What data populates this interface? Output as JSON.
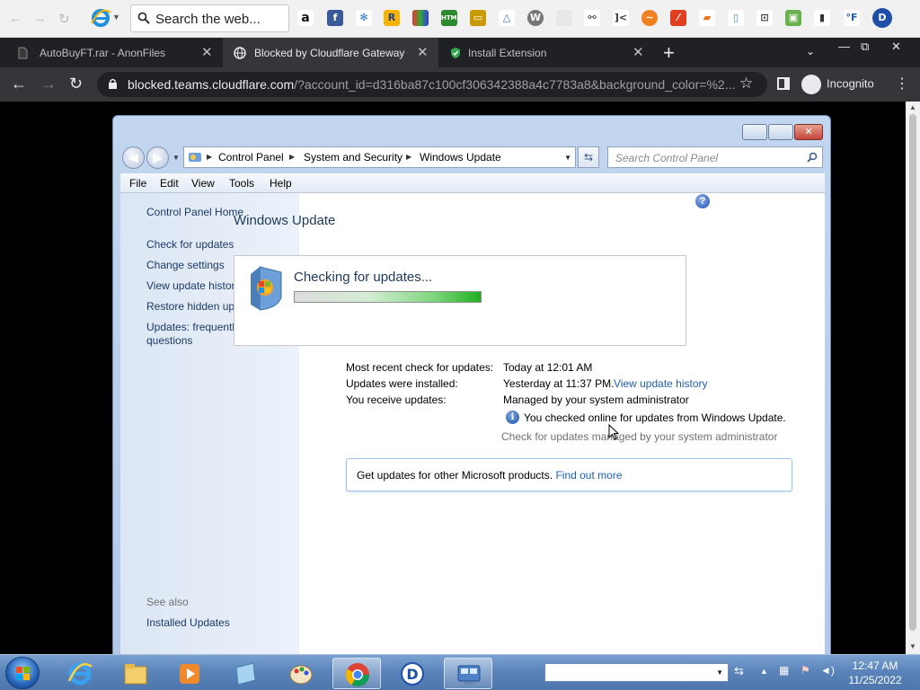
{
  "top_toolbar": {
    "search_placeholder": "Search the web...",
    "extension_icons": [
      "amazon-icon",
      "facebook-icon",
      "snowflake-icon",
      "r-badge-icon",
      "puzzle-icon",
      "html-icon",
      "folder-icon",
      "triangle-icon",
      "wordpress-icon",
      "wolf-icon",
      "network-icon",
      "bracket-icon",
      "sun-icon",
      "slash-icon",
      "sneaker-icon",
      "copy-icon",
      "car-icon",
      "android-icon",
      "phone-icon",
      "fahrenheit-icon",
      "d-icon"
    ],
    "f_label": "°F",
    "d_label": "D"
  },
  "tabs": [
    {
      "title": "AutoBuyFT.rar - AnonFiles",
      "active": false,
      "icon": "file-icon"
    },
    {
      "title": "Blocked by Cloudflare Gateway",
      "active": true,
      "icon": "globe-icon"
    },
    {
      "title": "Install Extension",
      "active": false,
      "icon": "shield-check-icon"
    }
  ],
  "address_bar": {
    "url_host": "blocked.teams.cloudflare.com",
    "url_rest": "/?account_id=d316ba87c100cf306342388a4c7783a8&background_color=%2...",
    "profile_label": "Incognito"
  },
  "cp_window": {
    "breadcrumb": [
      "Control Panel",
      "System and Security",
      "Windows Update"
    ],
    "search_placeholder": "Search Control Panel",
    "menu": [
      "File",
      "Edit",
      "View",
      "Tools",
      "Help"
    ],
    "left_links": [
      "Control Panel Home",
      "Check for updates",
      "Change settings",
      "View update history",
      "Restore hidden updates",
      "Updates: frequently asked questions"
    ],
    "see_also_label": "See also",
    "see_also_links": [
      "Installed Updates"
    ],
    "title": "Windows Update",
    "status_text": "Checking for updates...",
    "progress_fraction": 1.0,
    "info_rows": [
      {
        "label": "Most recent check for updates:",
        "value": "Today at 12:01 AM"
      },
      {
        "label": "Updates were installed:",
        "value": "Yesterday at 11:37 PM.",
        "link": "View update history"
      },
      {
        "label": "You receive updates:",
        "value": "Managed by your system administrator"
      }
    ],
    "online_note": "You checked online for updates from Windows Update.",
    "gray_note": "Check for updates managed by your system administrator",
    "other_products_text": "Get updates for other Microsoft products.",
    "other_products_link": "Find out more"
  },
  "taskbar": {
    "pinned": [
      "ie-icon",
      "explorer-icon",
      "media-player-icon",
      "notepad-icon",
      "paint-icon",
      "chrome-icon",
      "d-app-icon",
      "control-panel-icon"
    ],
    "active_index": 5,
    "time": "12:47 AM",
    "date": "11/25/2022"
  },
  "colors": {
    "chrome_dark": "#202124",
    "chrome_mid": "#35363a",
    "win7_link": "#1e3966",
    "win7_title": "#1e395b",
    "progress_green": "#20b020"
  }
}
